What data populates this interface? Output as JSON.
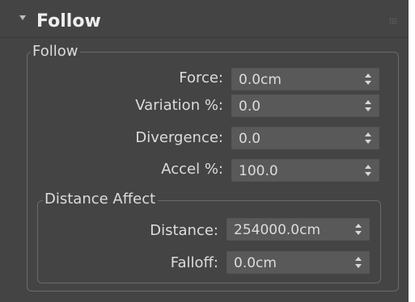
{
  "rollout": {
    "title": "Follow",
    "icons": {
      "collapse": "collapse-triangle-icon",
      "grip": "drag-grip-icon"
    }
  },
  "follow_group": {
    "label": "Follow",
    "fields": [
      {
        "label": "Force:",
        "value": "0.0cm"
      },
      {
        "label": "Variation %:",
        "value": "0.0"
      },
      {
        "label": "Divergence:",
        "value": "0.0"
      },
      {
        "label": "Accel %:",
        "value": "100.0"
      }
    ]
  },
  "distance_affect_group": {
    "label": "Distance Affect",
    "fields": [
      {
        "label": "Distance:",
        "value": "254000.0cm"
      },
      {
        "label": "Falloff:",
        "value": "0.0cm"
      }
    ]
  },
  "colors": {
    "panel_bg": "#444444",
    "spinner_bg": "#595959",
    "text": "#dcdcdc",
    "title_text": "#eeeeee",
    "group_border": "#6a6a6a"
  }
}
